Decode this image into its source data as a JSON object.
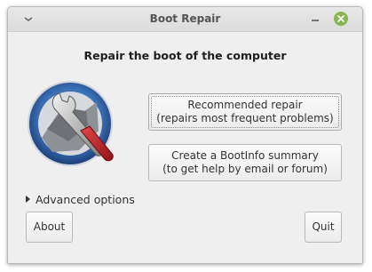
{
  "window": {
    "title": "Boot Repair"
  },
  "main": {
    "heading": "Repair the boot of the computer",
    "recommended": {
      "line1": "Recommended repair",
      "line2": "(repairs most frequent problems)"
    },
    "bootinfo": {
      "line1": "Create a BootInfo summary",
      "line2": "(to get help by email or forum)"
    },
    "advanced_label": "Advanced options"
  },
  "footer": {
    "about_label": "About",
    "quit_label": "Quit"
  },
  "icons": {
    "menu": "chevron-down-icon",
    "minimize": "minimize-icon",
    "close": "close-icon",
    "logo": "wrench-logo-icon",
    "expander": "triangle-right-icon"
  },
  "colors": {
    "close_button": "#87b550",
    "window_bg": "#efefef",
    "logo_ring": "#3a6fb5",
    "wrench_handle": "#c0282c"
  }
}
